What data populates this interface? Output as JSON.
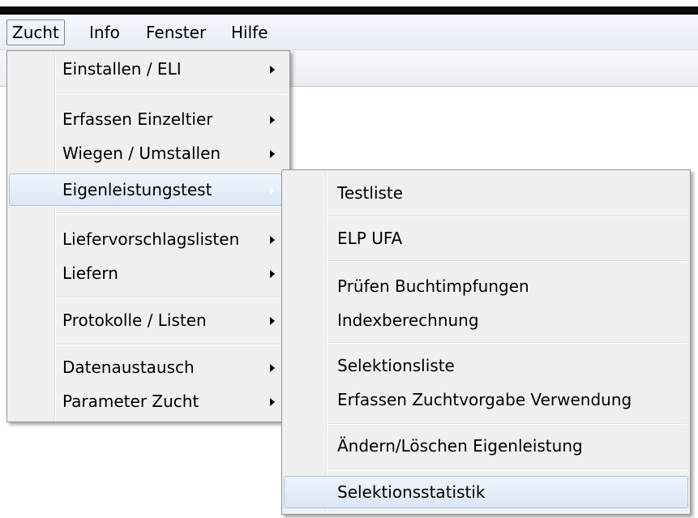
{
  "menubar": {
    "items": [
      "Zucht",
      "Info",
      "Fenster",
      "Hilfe"
    ]
  },
  "zucht_menu": {
    "items": [
      {
        "label": "Einstallen / ELI",
        "submenu": true
      },
      {
        "label": "Erfassen Einzeltier",
        "submenu": true
      },
      {
        "label": "Wiegen / Umstallen",
        "submenu": true
      },
      {
        "label": "Eigenleistungstest",
        "submenu": true,
        "highlighted": true
      },
      {
        "label": "Liefervorschlagslisten",
        "submenu": true
      },
      {
        "label": "Liefern",
        "submenu": true
      },
      {
        "label": "Protokolle / Listen",
        "submenu": true
      },
      {
        "label": "Datenaustausch",
        "submenu": true
      },
      {
        "label": "Parameter Zucht",
        "submenu": true
      }
    ]
  },
  "eigenleistung_menu": {
    "items": [
      {
        "label": "Testliste"
      },
      {
        "label": "ELP UFA"
      },
      {
        "label": "Prüfen Buchtimpfungen"
      },
      {
        "label": "Indexberechnung"
      },
      {
        "label": "Selektionsliste"
      },
      {
        "label": "Erfassen Zuchtvorgabe Verwendung"
      },
      {
        "label": "Ändern/Löschen Eigenleistung"
      },
      {
        "label": "Selektionsstatistik",
        "highlighted": true
      }
    ]
  }
}
